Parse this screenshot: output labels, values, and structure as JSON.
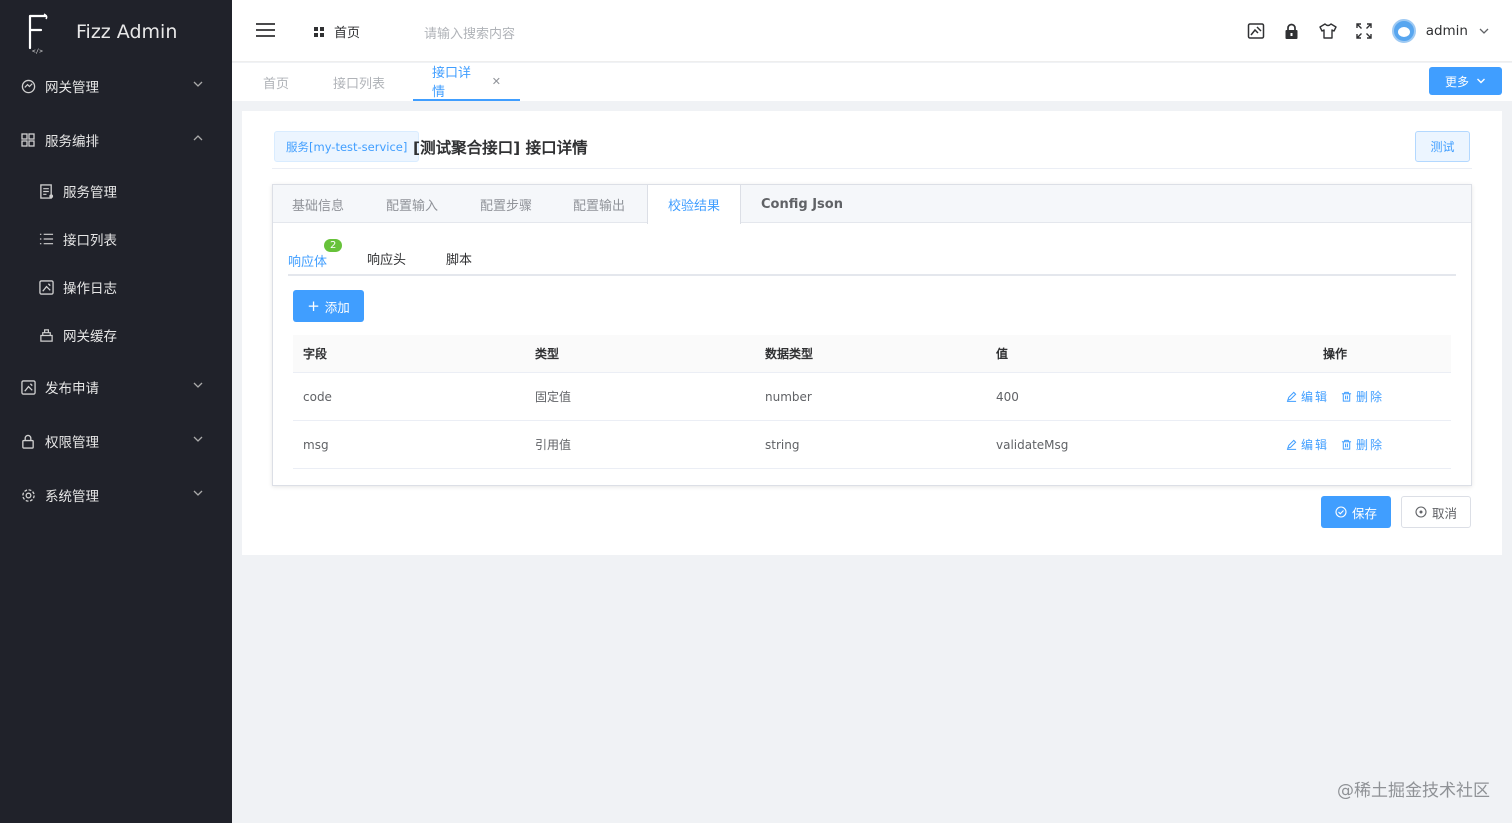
{
  "brand": {
    "title": "Fizz Admin",
    "logo_icon": "fizz-f-logo"
  },
  "sidebar": {
    "items": [
      {
        "label": "网关管理",
        "icon": "gateway-icon",
        "expanded": false
      },
      {
        "label": "服务编排",
        "icon": "grid-icon",
        "expanded": true
      },
      {
        "label": "发布申请",
        "icon": "publish-icon",
        "expanded": false
      },
      {
        "label": "权限管理",
        "icon": "lock-icon",
        "expanded": false
      },
      {
        "label": "系统管理",
        "icon": "gear-icon",
        "expanded": false
      }
    ],
    "sub_items": [
      {
        "label": "服务管理",
        "icon": "service-icon"
      },
      {
        "label": "接口列表",
        "icon": "list-icon"
      },
      {
        "label": "操作日志",
        "icon": "log-icon"
      },
      {
        "label": "网关缓存",
        "icon": "cache-icon"
      }
    ]
  },
  "header": {
    "home": "首页",
    "search_placeholder": "请输入搜索内容",
    "username": "admin",
    "icons": [
      "screenshot-icon",
      "lock-icon",
      "shirt-icon",
      "fullscreen-icon"
    ]
  },
  "tabs": {
    "items": [
      {
        "label": "首页"
      },
      {
        "label": "接口列表"
      },
      {
        "label": "接口详情",
        "active": true,
        "closable": true
      }
    ],
    "more": "更多"
  },
  "detail": {
    "service_tag": "服务[my-test-service]",
    "title": "[测试聚合接口] 接口详情",
    "test_button": "测试",
    "main_tabs": [
      {
        "label": "基础信息"
      },
      {
        "label": "配置输入"
      },
      {
        "label": "配置步骤"
      },
      {
        "label": "配置输出"
      },
      {
        "label": "校验结果",
        "active": true
      },
      {
        "label": "Config Json"
      }
    ],
    "sub_tabs": [
      {
        "label": "响应体",
        "active": true,
        "badge": "2"
      },
      {
        "label": "响应头"
      },
      {
        "label": "脚本"
      }
    ],
    "add_button": "添加",
    "table": {
      "columns": [
        "字段",
        "类型",
        "数据类型",
        "值",
        "操作"
      ],
      "rows": [
        {
          "field": "code",
          "type": "固定值",
          "data_type": "number",
          "value": "400"
        },
        {
          "field": "msg",
          "type": "引用值",
          "data_type": "string",
          "value": "validateMsg"
        }
      ],
      "edit_label": "编辑",
      "delete_label": "删除"
    },
    "save_button": "保存",
    "cancel_button": "取消"
  },
  "watermark": "@稀土掘金技术社区",
  "colors": {
    "accent": "#409eff",
    "sidebar_bg": "#20222a",
    "badge": "#67c23a"
  }
}
